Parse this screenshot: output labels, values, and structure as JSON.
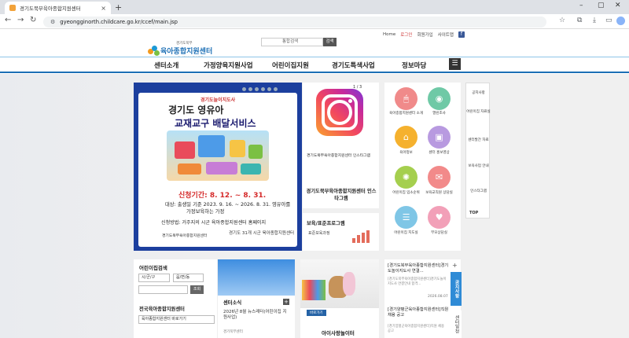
{
  "browser": {
    "tab_title": "경기도북부육아종합지원센터",
    "url": "gyeongginorth.childcare.go.kr/ccef/main.jsp"
  },
  "header": {
    "links": [
      "Home",
      "로그인",
      "회원가입",
      "사이트맵"
    ],
    "logo_top": "경기도북부",
    "logo_name": "육아종합지원센터",
    "logo_sub": "경기도북부 육아종합",
    "search_placeholder": "통합검색",
    "search_button": "검색"
  },
  "gnb": [
    "센터소개",
    "가정양육지원사업",
    "어린이집지원",
    "경기도특색사업",
    "정보마당"
  ],
  "banner": {
    "pre": "경기도늘이지도사",
    "title1": "경기도 영유아",
    "title2": "교재교구 배달서비스",
    "period": "신청기간: 8. 12. ~ 8. 31.",
    "target1": "대상: 출생일 기준 2023. 9. 16. ~ 2026. 8. 31. 영유아를",
    "target2": "가정보육하는 가정",
    "method": "신청방법: 거주지의 시군 육아종합지원센터 홈페이지",
    "org1": "경기도북부육아종합지원센터",
    "org2": "경기도 31개 시군 육아종합지원센터"
  },
  "insta": {
    "pager": "1 / 3",
    "caption": "경기도북부육아종합지원센터 인스타그램",
    "title": "경기도북부육아종합지원센터 인스타그램"
  },
  "program": {
    "title": "보육/표준프로그램",
    "item": "표준보육과정"
  },
  "quick": [
    {
      "label": "육아종합지원센터 소개",
      "color": "#f08a8a",
      "icon": "mouse-icon"
    },
    {
      "label": "열린조사",
      "color": "#6fc9a6",
      "icon": "camera-icon"
    },
    {
      "label": "육아정보",
      "color": "#f5b12e",
      "icon": "home-icon"
    },
    {
      "label": "센터 홍보영상",
      "color": "#b89ae0",
      "icon": "tv-icon"
    },
    {
      "label": "어린이집 입소순위",
      "color": "#a5cf4e",
      "icon": "gear-icon"
    },
    {
      "label": "보육교직원 상담실",
      "color": "#f28a8a",
      "icon": "chat-icon"
    },
    {
      "label": "어린이집 지도실",
      "color": "#7fc6e6",
      "icon": "list-icon"
    },
    {
      "label": "부모상담실",
      "color": "#f2a0b8",
      "icon": "heart-icon"
    }
  ],
  "side_menu": [
    "공지사항",
    "어린이집 자료실",
    "센터발간 자료",
    "보육사업 안내",
    "인스타그램"
  ],
  "side_top": "TOP",
  "kids": {
    "title": "어린이집검색",
    "sel1": "시/군/구",
    "sel2": "읍/면/동",
    "btn": "조회",
    "title2": "전국육아종합지원센터",
    "sel3": "육아종합지원센터 바로가기"
  },
  "news": {
    "title": "센터소식",
    "text": "2026년 8월 뉴스레터(어린이집 지원사업)",
    "sub": "경기북부센터"
  },
  "play": {
    "btn": "바로가기",
    "title": "아이사랑놀이터"
  },
  "notice": {
    "tab1": "공지사항",
    "tab2": "센터일정",
    "item1": "[경기도북부육아종합지원센터]경기도놀이지도사 연결...",
    "sub1": "[경기도북부육아종합지원센터]경기도놀이지도사 연결안내 합격...",
    "date1": "2026.08.07",
    "item2": "[경기양평군육아종합지원센터]직원 채용 공고",
    "sub2": "[경기양평군육아종합지원센터]직원 채용 공고"
  }
}
